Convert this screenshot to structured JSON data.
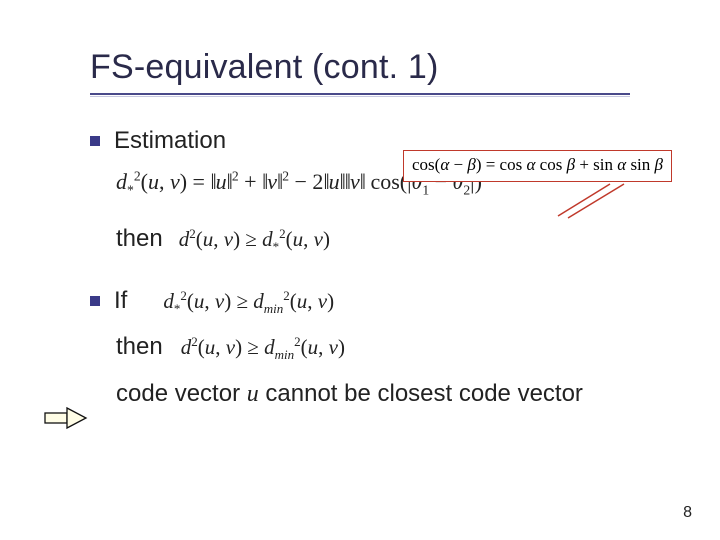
{
  "title": "FS-equivalent (cont. 1)",
  "callout_formula": "cos(α − β) = cos α cos β + sin α sin β",
  "bullets": {
    "b1_label": "Estimation",
    "eq1": "d*²(u, v) = ‖u‖² + ‖v‖² − 2‖u‖‖v‖ cos(|θ₁ − θ₂|)",
    "then_word": "then",
    "eq2": "d²(u, v) ≥ d*²(u, v)",
    "b2_if": "If",
    "eq3": "d*²(u, v) ≥ d²min(u, v)",
    "eq4": "d²(u, v) ≥ d²min(u, v)",
    "conclusion_pre": "code vector ",
    "conclusion_var": "u",
    "conclusion_post": " cannot be closest code vector"
  },
  "page_number": "8"
}
